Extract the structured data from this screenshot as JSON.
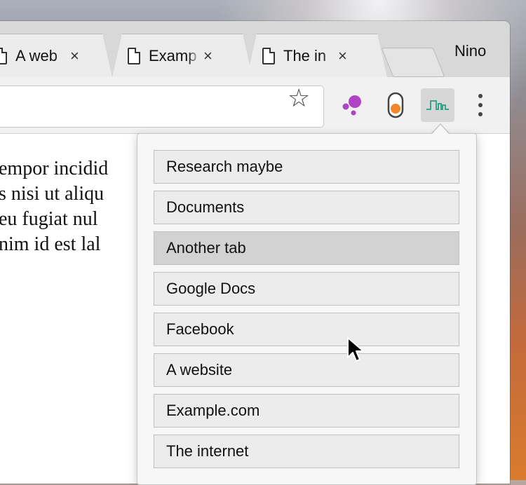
{
  "tabs": [
    {
      "title": "A web",
      "close": "×"
    },
    {
      "title": "Examp",
      "close": "×"
    },
    {
      "title": "The in",
      "close": "×"
    }
  ],
  "profile": {
    "name": "Nino"
  },
  "toolbar": {
    "bookmark_star": "☆"
  },
  "page_text": {
    "lines": [
      "empor incidid",
      "s nisi ut aliqu",
      "eu fugiat nul",
      "nim id est lal"
    ]
  },
  "popup": {
    "items": [
      {
        "label": "Research maybe"
      },
      {
        "label": "Documents"
      },
      {
        "label": "Another tab"
      },
      {
        "label": "Google Docs"
      },
      {
        "label": "Facebook"
      },
      {
        "label": "A website"
      },
      {
        "label": "Example.com"
      },
      {
        "label": "The internet"
      }
    ],
    "highlighted_index": 2
  },
  "colors": {
    "popup_bg": "#f7f7f7",
    "item_bg": "#ececec",
    "item_highlight": "#d2d2d2",
    "ext_purple": "#b043c5",
    "ext_orange": "#f2882b",
    "ext_green": "#3aa58a"
  }
}
